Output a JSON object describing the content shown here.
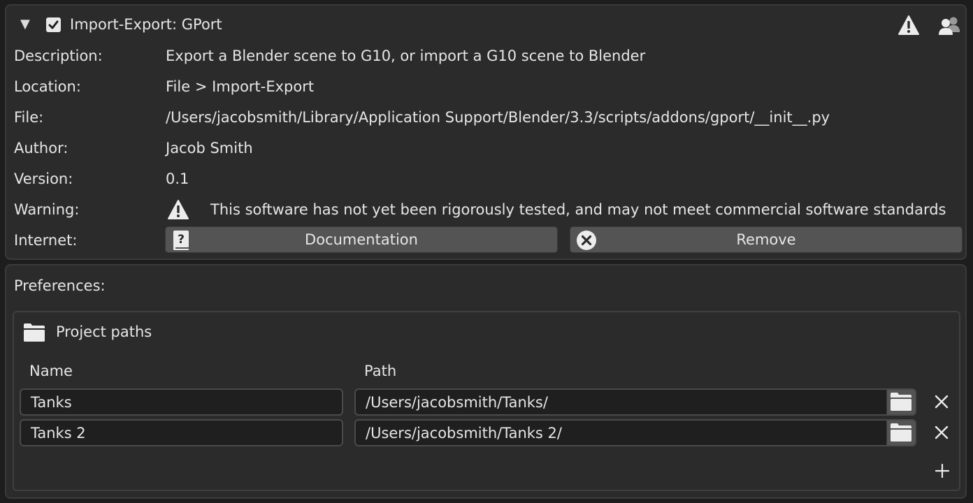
{
  "addon": {
    "title": "Import-Export: GPort",
    "enabled": true,
    "expanded": true,
    "header_icons": [
      "warning-icon",
      "user-community-icon"
    ],
    "fields": {
      "description": {
        "label": "Description:",
        "value": "Export a Blender scene to G10, or import a G10 scene to Blender"
      },
      "location": {
        "label": "Location:",
        "value": "File > Import-Export"
      },
      "file": {
        "label": "File:",
        "value": "/Users/jacobsmith/Library/Application Support/Blender/3.3/scripts/addons/gport/__init__.py"
      },
      "author": {
        "label": "Author:",
        "value": "Jacob Smith"
      },
      "version": {
        "label": "Version:",
        "value": "0.1"
      },
      "warning": {
        "label": "Warning:",
        "value": "This software has not yet been rigorously tested, and may not meet commercial software standards"
      },
      "internet": {
        "label": "Internet:"
      }
    },
    "buttons": {
      "documentation": "Documentation",
      "remove": "Remove"
    }
  },
  "preferences": {
    "label": "Preferences:",
    "project_paths": {
      "title": "Project paths",
      "columns": {
        "name": "Name",
        "path": "Path"
      },
      "rows": [
        {
          "name": "Tanks",
          "path": "/Users/jacobsmith/Tanks/"
        },
        {
          "name": "Tanks 2",
          "path": "/Users/jacobsmith/Tanks 2/"
        }
      ]
    }
  },
  "colors": {
    "background": "#1d1d1d",
    "panel": "#2b2b2b",
    "button": "#545454",
    "field": "#1f1f1f",
    "text": "#e6e6e6"
  }
}
